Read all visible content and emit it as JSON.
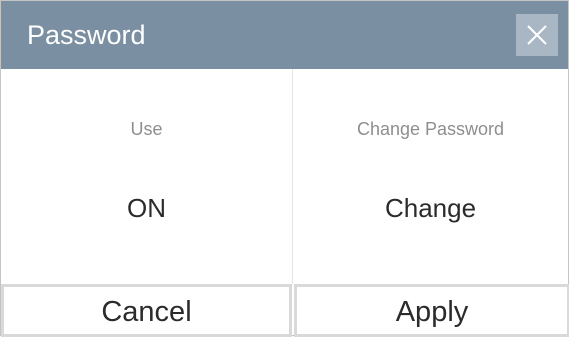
{
  "dialog": {
    "title": "Password",
    "close_icon": "close-icon"
  },
  "settings": {
    "use": {
      "label": "Use",
      "value": "ON"
    },
    "change_password": {
      "label": "Change Password",
      "value": "Change"
    }
  },
  "footer": {
    "cancel_label": "Cancel",
    "apply_label": "Apply"
  },
  "colors": {
    "titlebar": "#7b8fa2",
    "close_button": "#a9b7c4",
    "label_text": "#8e8e8e",
    "value_text": "#2b2b2b"
  }
}
